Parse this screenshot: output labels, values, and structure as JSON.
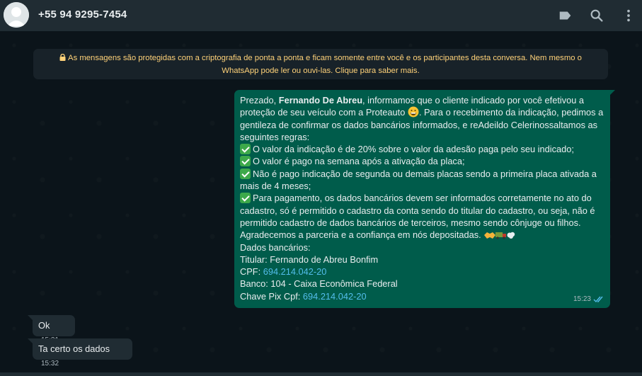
{
  "header": {
    "contact_name": "+55 94 9295-7454",
    "icons": [
      "label-icon",
      "search-icon",
      "menu-icon"
    ]
  },
  "notice": {
    "text": "As mensagens são protegidas com a criptografia de ponta a ponta e ficam somente entre você e os participantes desta conversa. Nem mesmo o WhatsApp pode ler ou ouvi-las. Clique para saber mais."
  },
  "outgoing": {
    "intro_1": "Prezado, ",
    "recipient_name": "Fernando De Abreu",
    "intro_2": ", informamos que o cliente indicado por você efetivou a proteção de seu veículo com a Proteauto ",
    "intro_3": ". Para o recebimento da indicação, pedimos a gentileza de confirmar os dados bancários informados, e reAdeildo Celerinossaltamos as seguintes regras:",
    "rules": [
      "O valor da indicação é de 20% sobre o valor da adesão paga pelo seu indicado;",
      "O valor é pago na semana após a ativação da placa;",
      "Não é pago indicação de segunda ou demais placas sendo a primeira placa ativada a mais de 4 meses;",
      "Para pagamento, os dados bancários devem ser informados corretamente no ato do cadastro, só é permitido o cadastro da conta sendo do titular do cadastro, ou seja, não é permitido cadastro de dados bancários de terceiros, mesmo sendo cônjuge ou filhos."
    ],
    "thanks": "Agradecemos a parceria e a confiança em nós depositadas. ",
    "bank_heading": "Dados bancários:",
    "titular_label": "Titular: ",
    "titular_value": "Fernando de Abreu Bonfim",
    "cpf_label": "CPF: ",
    "cpf_value": "694.214.042-20",
    "banco_label": "Banco: ",
    "banco_value": "104 - Caixa Econômica Federal",
    "pix_label": "Chave Pix Cpf: ",
    "pix_value": "694.214.042-20",
    "time": "15:23"
  },
  "incoming": [
    {
      "text": "Ok",
      "time": "15:31"
    },
    {
      "text": "Ta certo os dados",
      "time": "15:32"
    }
  ],
  "colors": {
    "outgoing_bubble": "#005c4b",
    "incoming_bubble": "#202c33",
    "link": "#53bdeb",
    "notice_text": "#ffd279",
    "read_ticks": "#53bdeb"
  }
}
